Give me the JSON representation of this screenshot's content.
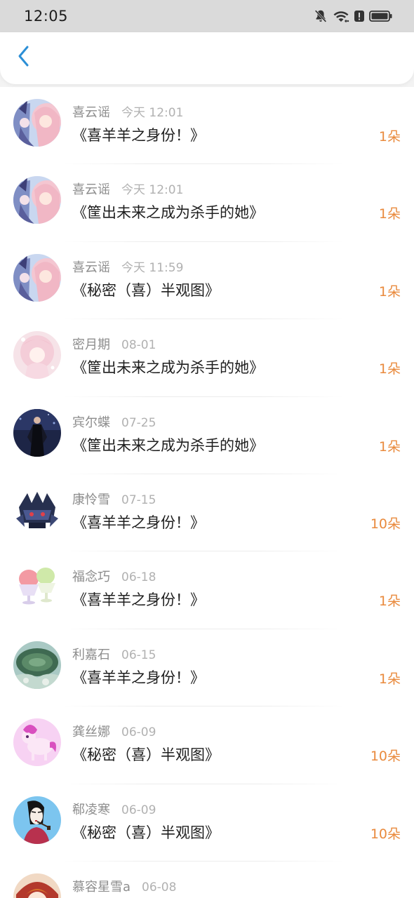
{
  "status_bar": {
    "time": "12:05",
    "icons": [
      "mute-bell-icon",
      "wifi-icon",
      "alert-icon",
      "battery-icon"
    ]
  },
  "header": {
    "back_icon": "chevron-left-icon",
    "accent_color": "#2c8fd6"
  },
  "colors": {
    "flower_count": "#e98a3d",
    "username": "#8d8d8d",
    "time": "#b1b1b1",
    "title": "#1f1f1f"
  },
  "items": [
    {
      "username": "喜云谣",
      "time": "今天 12:01",
      "title": "《喜羊羊之身份！》",
      "flowers": "1朵",
      "avatar": "anime-girl-pink-hair"
    },
    {
      "username": "喜云谣",
      "time": "今天 12:01",
      "title": "《筐出未来之成为杀手的她》",
      "flowers": "1朵",
      "avatar": "anime-girl-pink-hair"
    },
    {
      "username": "喜云谣",
      "time": "今天 11:59",
      "title": "《秘密（喜）半观图》",
      "flowers": "1朵",
      "avatar": "anime-girl-pink-hair"
    },
    {
      "username": "密月期",
      "time": "08-01",
      "title": "《筐出未来之成为杀手的她》",
      "flowers": "1朵",
      "avatar": "pastel-anime-girl"
    },
    {
      "username": "宾尔蝶",
      "time": "07-25",
      "title": "《筐出未来之成为杀手的她》",
      "flowers": "1朵",
      "avatar": "woman-in-black-dress"
    },
    {
      "username": "康怜雪",
      "time": "07-15",
      "title": "《喜羊羊之身份！》",
      "flowers": "10朵",
      "avatar": "robot-mecha"
    },
    {
      "username": "福念巧",
      "time": "06-18",
      "title": "《喜羊羊之身份！》",
      "flowers": "1朵",
      "avatar": "shaved-ice-cups"
    },
    {
      "username": "利嘉石",
      "time": "06-15",
      "title": "《喜羊羊之身份！》",
      "flowers": "1朵",
      "avatar": "cactus"
    },
    {
      "username": "龚丝娜",
      "time": "06-09",
      "title": "《秘密（喜）半观图》",
      "flowers": "10朵",
      "avatar": "pink-pony"
    },
    {
      "username": "郗凌寒",
      "time": "06-09",
      "title": "《秘密（喜）半观图》",
      "flowers": "10朵",
      "avatar": "woman-with-pipe"
    },
    {
      "username": "慕容星雪a",
      "time": "06-08",
      "title": "",
      "flowers": "",
      "avatar": "anime-character-red"
    }
  ]
}
